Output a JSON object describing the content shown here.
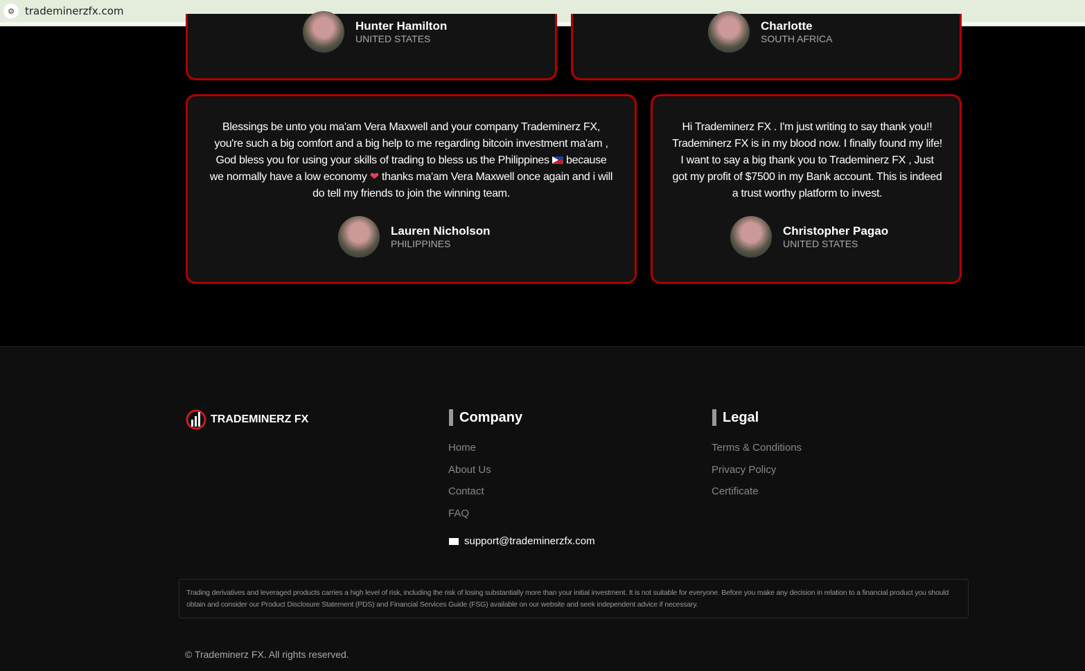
{
  "browser": {
    "url": "trademinerzfx.com"
  },
  "testimonials_top": [
    {
      "name": "Hunter Hamilton",
      "country": "UNITED STATES"
    },
    {
      "name": "Charlotte",
      "country": "SOUTH AFRICA"
    }
  ],
  "testimonials": [
    {
      "text_part1": "Blessings be unto you ma'am Vera Maxwell and your company Trademinerz FX, you're such a big comfort and a big help to me regarding bitcoin investment ma'am , God bless you for using your skills of trading to bless us the Philippines",
      "text_part2": "because we normally have a low economy",
      "text_part3": "thanks ma'am Vera Maxwell once again and i will do tell my friends to join the winning team.",
      "heart": "❤",
      "name": "Lauren Nicholson",
      "country": "PHILIPPINES"
    },
    {
      "text": "Hi Trademinerz FX . I'm just writing to say thank you!! Trademinerz FX is in my blood now. I finally found my life! I want to say a big thank you to Trademinerz FX , Just got my profit of $7500 in my Bank account. This is indeed a trust worthy platform to invest.",
      "name": "Christopher Pagao",
      "country": "UNITED STATES"
    }
  ],
  "footer": {
    "brand": "TRADEMINERZ FX",
    "company": {
      "title": "Company",
      "links": [
        "Home",
        "About Us",
        "Contact",
        "FAQ"
      ]
    },
    "legal": {
      "title": "Legal",
      "links": [
        "Terms & Conditions",
        "Privacy Policy",
        "Certificate"
      ]
    },
    "email": "support@trademinerzfx.com",
    "disclaimer": "Trading derivatives and leveraged products carries a high level of risk, including the risk of losing substantially more than your initial investment. It is not suitable for everyone. Before you make any decision in relation to a financial product you should obtain and consider our Product Disclosure Statement (PDS) and Financial Services Guide (FSG) available on our website and seek independent advice if necessary.",
    "copyright": "© Trademinerz FX. All rights reserved."
  },
  "colors": {
    "accent": "#b10000",
    "card": "#131313",
    "footer": "#0f0f0f"
  }
}
